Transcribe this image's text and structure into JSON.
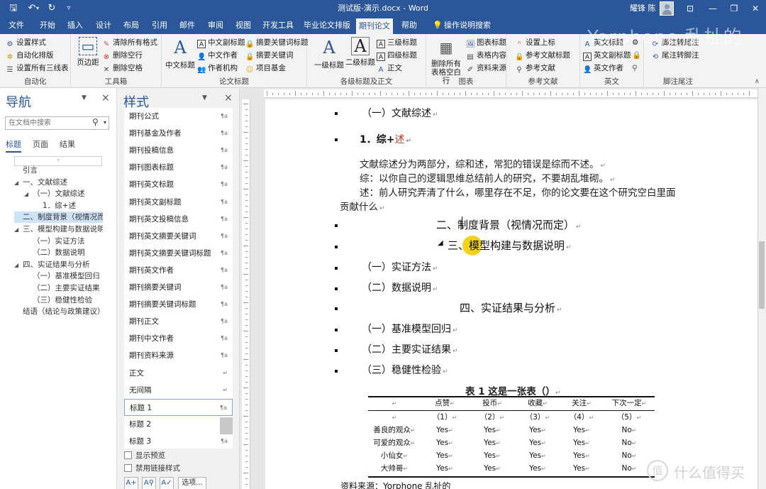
{
  "titlebar": {
    "quick_access": {
      "save": "🖫",
      "undo": "↶",
      "undo_arrow": "▾",
      "redo": "↻",
      "customize": "▿"
    },
    "doc_title": "测试版-演示.docx - Word",
    "user_name": "耀锋 陈",
    "window_buttons": {
      "ribbon_display": "⊡",
      "minimize": "—",
      "restore": "❐",
      "close": "✕"
    }
  },
  "tabs": [
    "文件",
    "开始",
    "插入",
    "设计",
    "布局",
    "引用",
    "邮件",
    "审阅",
    "视图",
    "开发工具",
    "毕业论文排版",
    "期刊论文",
    "帮助",
    "操作说明搜索"
  ],
  "active_tab": "期刊论文",
  "watermark": "Yorphone 乱扯的",
  "share": "共享",
  "ribbon": {
    "auto": {
      "label": "自动化",
      "items": [
        "设置样式",
        "自动化排版",
        "设置所有三线表"
      ]
    },
    "toolbox": {
      "label": "工具箱",
      "big": "页边距",
      "items": [
        "清除所有格式",
        "删除空行",
        "删除空格"
      ]
    },
    "paper_title": {
      "label": "论文标题",
      "big": "中文标题",
      "items": [
        "中文副标题",
        "中文作者",
        "作者机构",
        "摘要关键词标题",
        "摘要关键词",
        "项目基金"
      ]
    },
    "headings": {
      "label": "各级标题及正文",
      "big1": "一级标题",
      "big2": "二级标题",
      "items": [
        "三级标题",
        "四级标题",
        "正文"
      ]
    },
    "figures": {
      "label": "图表",
      "big": "删除所有表格空白行",
      "items": [
        "图表标题",
        "表格内容",
        "资料来源"
      ]
    },
    "references": {
      "label": "参考文献",
      "items": [
        "设置上标",
        "参考文献标题",
        "参考文献"
      ]
    },
    "english": {
      "label": "英文",
      "items": [
        "英文标题",
        "英文副标题",
        "英文作者"
      ]
    },
    "footnotes": {
      "label": "脚注尾注",
      "items": [
        "脚注转尾注",
        "尾注转脚注"
      ]
    }
  },
  "nav": {
    "title": "导航",
    "search_placeholder": "在文档中搜索",
    "tabs": [
      "标题",
      "页面",
      "结果"
    ],
    "active_tab": "标题",
    "items": [
      {
        "text": "引言",
        "level": 0,
        "collapsible": false
      },
      {
        "text": "一、文献综述",
        "level": 0,
        "collapsible": true
      },
      {
        "text": "（一）文献综述",
        "level": 1,
        "collapsible": true
      },
      {
        "text": "1．综+述",
        "level": 2,
        "collapsible": false
      },
      {
        "text": "二、制度背景（视情况而...",
        "level": 0,
        "collapsible": false,
        "selected": true
      },
      {
        "text": "三、模型构建与数据说明",
        "level": 0,
        "collapsible": true
      },
      {
        "text": "（一）实证方法",
        "level": 1,
        "collapsible": false
      },
      {
        "text": "（二）数据说明",
        "level": 1,
        "collapsible": false
      },
      {
        "text": "四、实证结果与分析",
        "level": 0,
        "collapsible": true
      },
      {
        "text": "（一）基准模型回归",
        "level": 1,
        "collapsible": false
      },
      {
        "text": "（二）主要实证结果",
        "level": 1,
        "collapsible": false
      },
      {
        "text": "（三）稳健性检验",
        "level": 1,
        "collapsible": false
      },
      {
        "text": "结语（结论与政策建议）",
        "level": 0,
        "collapsible": false
      }
    ]
  },
  "styles_pane": {
    "title": "样式",
    "items": [
      {
        "name": "期刊公式",
        "mark": "¶a"
      },
      {
        "name": "期刊基金及作者",
        "mark": "¶a"
      },
      {
        "name": "期刊投稿信息",
        "mark": "¶a"
      },
      {
        "name": "期刊图表标题",
        "mark": "¶a"
      },
      {
        "name": "期刊英文标题",
        "mark": "¶a"
      },
      {
        "name": "期刊英文副标题",
        "mark": "¶a"
      },
      {
        "name": "期刊英文投稿信息",
        "mark": "¶a"
      },
      {
        "name": "期刊英文摘要关键词",
        "mark": "¶a"
      },
      {
        "name": "期刊英文摘要关键词标题",
        "mark": "¶a"
      },
      {
        "name": "期刊英文作者",
        "mark": "¶a"
      },
      {
        "name": "期刊摘要关键词",
        "mark": "¶a"
      },
      {
        "name": "期刊摘要关键词标题",
        "mark": "¶a"
      },
      {
        "name": "期刊正文",
        "mark": "¶a"
      },
      {
        "name": "期刊中文作者",
        "mark": "¶a"
      },
      {
        "name": "期刊资料来源",
        "mark": "¶a"
      },
      {
        "name": "正文",
        "mark": "↵"
      },
      {
        "name": "无间隔",
        "mark": "↵"
      },
      {
        "name": "标题 1",
        "mark": "¶a",
        "selected": true
      },
      {
        "name": "标题 2",
        "mark": "¶a"
      },
      {
        "name": "标题 3",
        "mark": "¶a"
      }
    ],
    "show_preview": "显示预览",
    "disable_linked": "禁用链接样式",
    "options_button": "选项..."
  },
  "document": {
    "h_review": "（一）文献综述",
    "h_zongshu_prefix": "1．综+",
    "h_zongshu_red": "述",
    "body1": "文献综述分为两部分，综和述，常犯的错误是综而不述。",
    "body2": "综：以你自己的逻辑思维总结前人的研究，不要胡乱堆砌。",
    "body3": "述：前人研究弄清了什么，哪里存在不足，你的论文要在这个研究空白里面",
    "body4": "贡献什么",
    "h2_1": "二、制度背景（视情况而定）",
    "h2_2_pre": "三、",
    "h2_2_cursor": "模",
    "h2_2_post": "型构建与数据说明",
    "h3_method": "（一）实证方法",
    "h3_data": "（二）数据说明",
    "h2_3": "四、实证结果与分析",
    "h3_base": "（一）基准模型回归",
    "h3_main": "（二）主要实证结果",
    "h3_robust": "（三）稳健性检验",
    "paragraph_mark": "↵",
    "table_title": "表 1  这是一张表（）",
    "table": {
      "headers": [
        "",
        "点赞",
        "投币",
        "收藏",
        "关注",
        "下次一定"
      ],
      "numbers": [
        "",
        "（1）",
        "（2）",
        "（3）",
        "（4）",
        "（5）"
      ],
      "rows": [
        [
          "善良的观众",
          "Yes",
          "Yes",
          "Yes",
          "Yes",
          "No"
        ],
        [
          "可爱的观众",
          "Yes",
          "Yes",
          "Yes",
          "Yes",
          "No"
        ],
        [
          "小仙女",
          "Yes",
          "Yes",
          "Yes",
          "Yes",
          "No"
        ],
        [
          "大帅哥",
          "Yes",
          "Yes",
          "Yes",
          "Yes",
          "No"
        ]
      ]
    },
    "source": "资料来源：Yorphone 乱扯的"
  },
  "footer_watermark": {
    "badge": "值",
    "text": "什么值得买"
  },
  "colors": {
    "brand": "#2b579a",
    "ribbon": "#f3f3f3",
    "highlight": "#f5d21a",
    "red_text": "#c0392b"
  }
}
